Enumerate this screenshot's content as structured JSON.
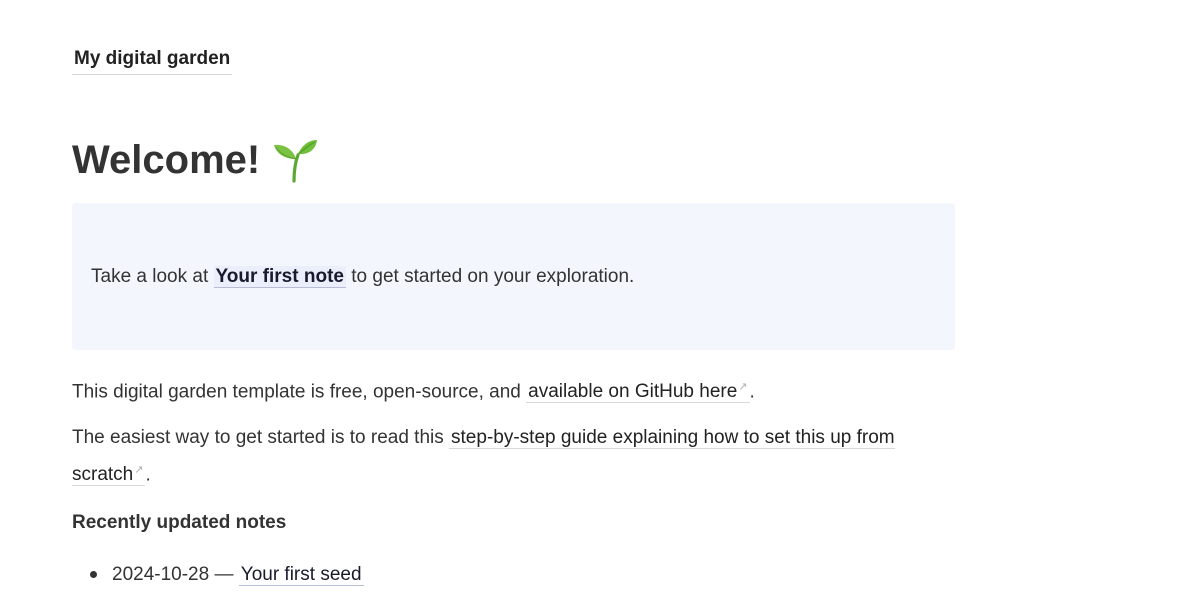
{
  "header": {
    "site_title": "My digital garden"
  },
  "main": {
    "heading": "Welcome!",
    "heading_emoji_icon": "seedling-icon",
    "callout": {
      "prefix": "Take a look at ",
      "link": "Your first note",
      "suffix": " to get started on your exploration."
    },
    "para1": {
      "prefix": "This digital garden template is free, open-source, and ",
      "link": "available on GitHub here",
      "suffix": "."
    },
    "para2": {
      "prefix": "The easiest way to get started is to read this ",
      "link": "step-by-step guide explaining how to set this up from scratch",
      "suffix": "."
    },
    "external_link_icon": "↗",
    "recent": {
      "heading": "Recently updated notes",
      "items": [
        {
          "date": "2024-10-28",
          "separator": " — ",
          "title": "Your first seed"
        }
      ]
    }
  },
  "colors": {
    "callout_bg": "#f3f6fd",
    "link_highlight": "#ebeefb",
    "text": "#333333",
    "sprout_green": "#6fbf3b"
  }
}
